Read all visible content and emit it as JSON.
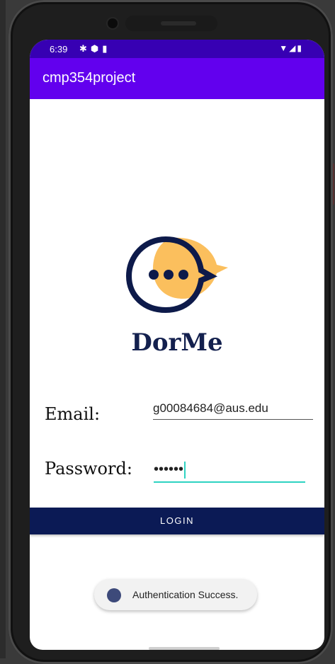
{
  "status_bar": {
    "time": "6:39",
    "left_icons": [
      "gear-icon",
      "shield-icon",
      "sd-card-icon"
    ],
    "right_icons": [
      "wifi-icon",
      "signal-icon",
      "battery-icon"
    ]
  },
  "app_bar": {
    "title": "cmp354project"
  },
  "brand": {
    "name": "DorMe"
  },
  "form": {
    "email_label": "Email:",
    "email_value": "g00084684@aus.edu",
    "password_label": "Password:",
    "password_value": "••••••",
    "login_label": "LOGIN"
  },
  "toast": {
    "message": "Authentication Success."
  },
  "colors": {
    "status_bar": "#3700b3",
    "app_bar": "#6200ee",
    "login_button": "#0b1a55",
    "brand_text": "#13204e",
    "logo_accent": "#fbbf5d",
    "input_focus": "#2ed3c2"
  }
}
